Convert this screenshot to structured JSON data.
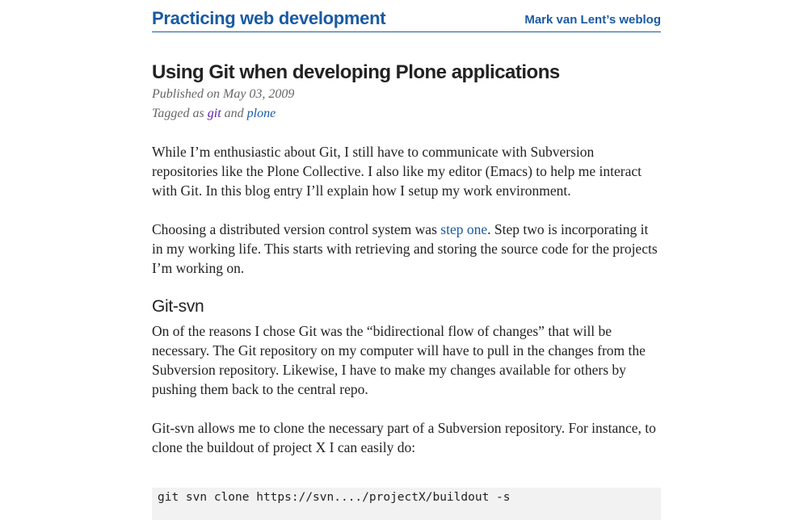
{
  "header": {
    "site_title": "Practicing web development",
    "site_subtitle": "Mark van Lent’s weblog"
  },
  "post": {
    "title": "Using Git when developing Plone applications",
    "published": "Published on May 03, 2009",
    "tagged_prefix": "Tagged as ",
    "tags": [
      "git",
      "plone"
    ],
    "tag_joiner": " and ",
    "paragraphs": {
      "p1": "While I’m enthusiastic about Git, I still have to communicate with Subversion repositories like the Plone Collective. I also like my editor (Emacs) to help me interact with Git. In this blog entry I’ll explain how I setup my work environment.",
      "p2_before": "Choosing a distributed version control system was ",
      "p2_link": "step one",
      "p2_after": ". Step two is incorporating it in my working life. This starts with retrieving and storing the source code for the projects I’m working on.",
      "p3": "On of the reasons I chose Git was the “bidirectional flow of changes” that will be necessary. The Git repository on my computer will have to pull in the changes from the Subversion repository. Likewise, I have to make my changes available for others by pushing them back to the central repo.",
      "p4": "Git-svn allows me to clone the necessary part of a Subversion repository. For instance, to clone the buildout of project X I can easily do:"
    },
    "section_heading": "Git-svn",
    "code": "git svn clone https://svn..../projectX/buildout -s"
  },
  "colors": {
    "link": "#1a5aa3",
    "visited_link": "#5b1fa8",
    "text": "#222222",
    "meta": "#666666",
    "code_bg": "#f2f2f2"
  }
}
